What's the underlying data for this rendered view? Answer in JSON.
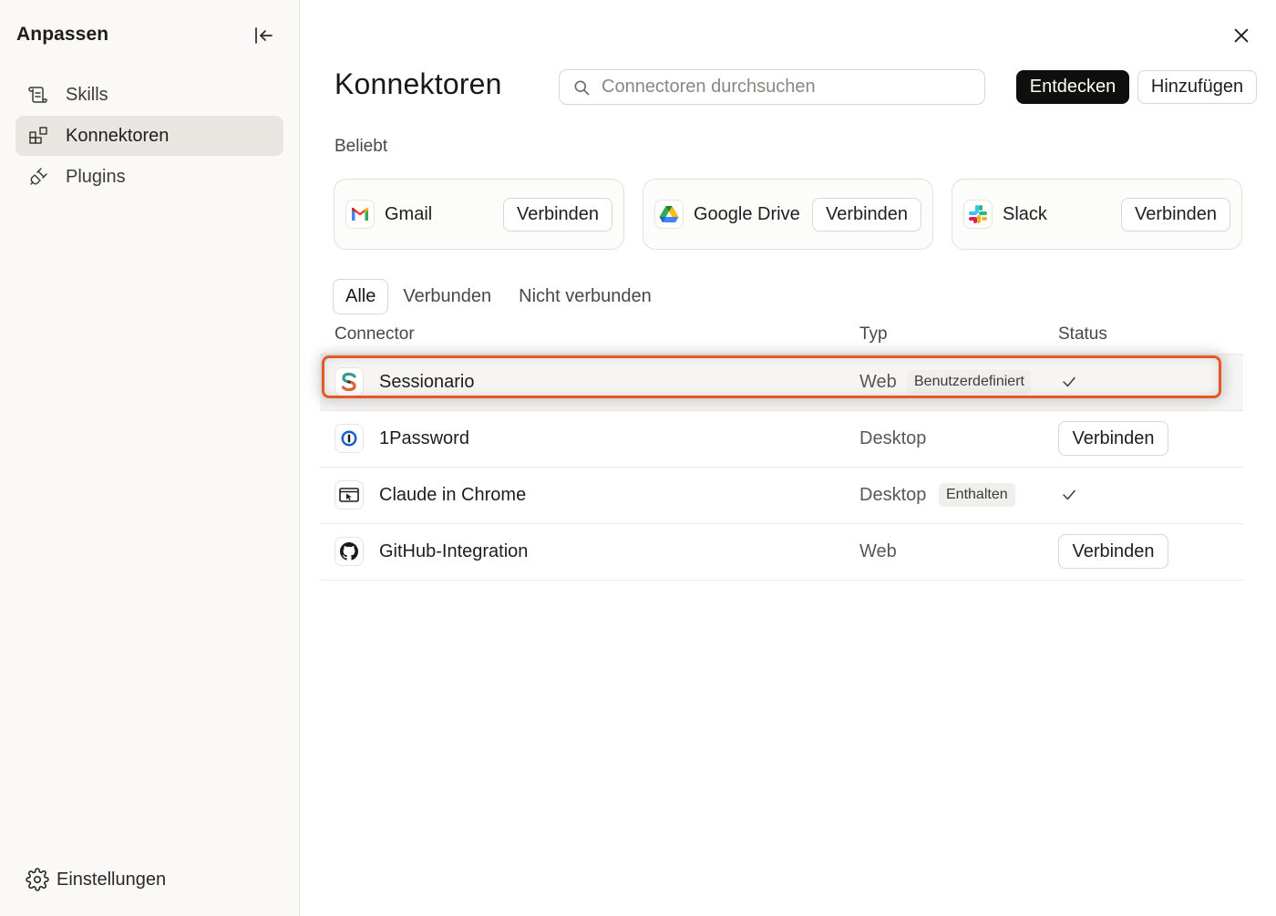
{
  "sidebar": {
    "title": "Anpassen",
    "items": [
      {
        "label": "Skills",
        "icon": "skills-icon"
      },
      {
        "label": "Konnektoren",
        "icon": "connectors-icon",
        "active": true
      },
      {
        "label": "Plugins",
        "icon": "plug-icon"
      }
    ],
    "settings_label": "Einstellungen"
  },
  "main": {
    "title": "Konnektoren",
    "search": {
      "placeholder": "Connectoren durchsuchen",
      "value": ""
    },
    "discover_label": "Entdecken",
    "add_label": "Hinzufügen",
    "popular_label": "Beliebt",
    "popular": [
      {
        "name": "Gmail",
        "icon": "gmail-icon",
        "action": "Verbinden"
      },
      {
        "name": "Google Drive",
        "icon": "google-drive-icon",
        "action": "Verbinden"
      },
      {
        "name": "Slack",
        "icon": "slack-icon",
        "action": "Verbinden"
      }
    ],
    "tabs": [
      {
        "label": "Alle",
        "active": true
      },
      {
        "label": "Verbunden"
      },
      {
        "label": "Nicht verbunden"
      }
    ],
    "columns": {
      "connector": "Connector",
      "type": "Typ",
      "status": "Status"
    },
    "rows": [
      {
        "name": "Sessionario",
        "icon": "sessionario-icon",
        "type": "Web",
        "tag": "Benutzerdefiniert",
        "status": "connected",
        "highlighted": true
      },
      {
        "name": "1Password",
        "icon": "onepassword-icon",
        "type": "Desktop",
        "tag": "",
        "action": "Verbinden"
      },
      {
        "name": "Claude in Chrome",
        "icon": "chrome-window-icon",
        "type": "Desktop",
        "tag": "Enthalten",
        "status": "connected"
      },
      {
        "name": "GitHub-Integration",
        "icon": "github-icon",
        "type": "Web",
        "tag": "",
        "action": "Verbinden"
      }
    ]
  },
  "colors": {
    "accent_dark": "#0f0f0e",
    "highlight_border": "#e2582b",
    "active_nav_bg": "#e8e6e1"
  }
}
